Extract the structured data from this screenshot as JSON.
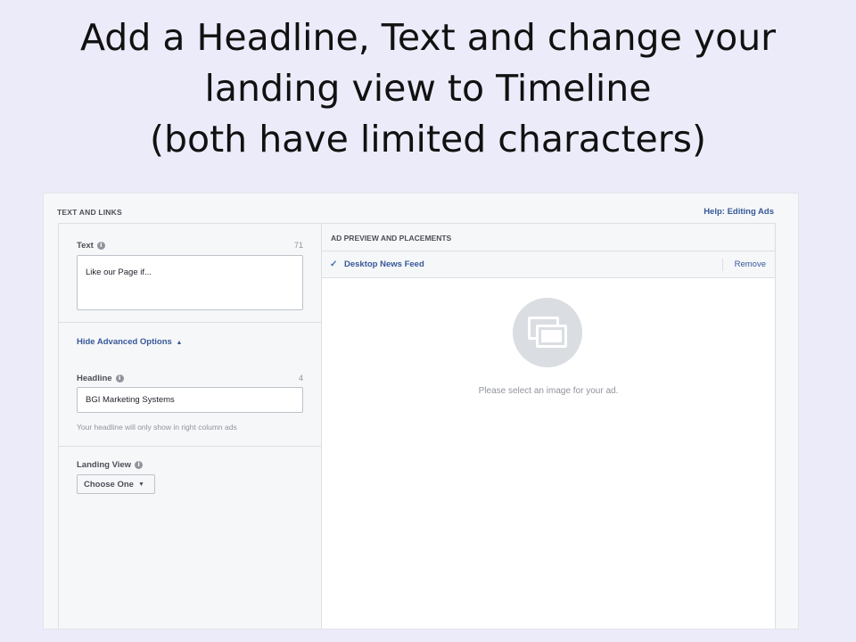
{
  "slide": {
    "title_lines": [
      "Add a Headline, Text and change your",
      "landing view to Timeline",
      "(both have limited characters)"
    ]
  },
  "header": {
    "title": "TEXT AND LINKS",
    "help_link": "Help: Editing Ads"
  },
  "text_field": {
    "label": "Text",
    "count": "71",
    "value": "Like our Page if..."
  },
  "advanced": {
    "toggle_label": "Hide Advanced Options",
    "caret": "▲"
  },
  "headline_field": {
    "label": "Headline",
    "count": "4",
    "value": "BGI Marketing Systems",
    "hint": "Your headline will only show in right column ads"
  },
  "landing_view": {
    "label": "Landing View",
    "selected": "Choose One",
    "arrow": "▼"
  },
  "preview": {
    "header": "AD PREVIEW AND PLACEMENTS",
    "placement": "Desktop News Feed",
    "check": "✓",
    "remove_label": "Remove",
    "empty_message": "Please select an image for your ad."
  },
  "icons": {
    "info": "i"
  }
}
